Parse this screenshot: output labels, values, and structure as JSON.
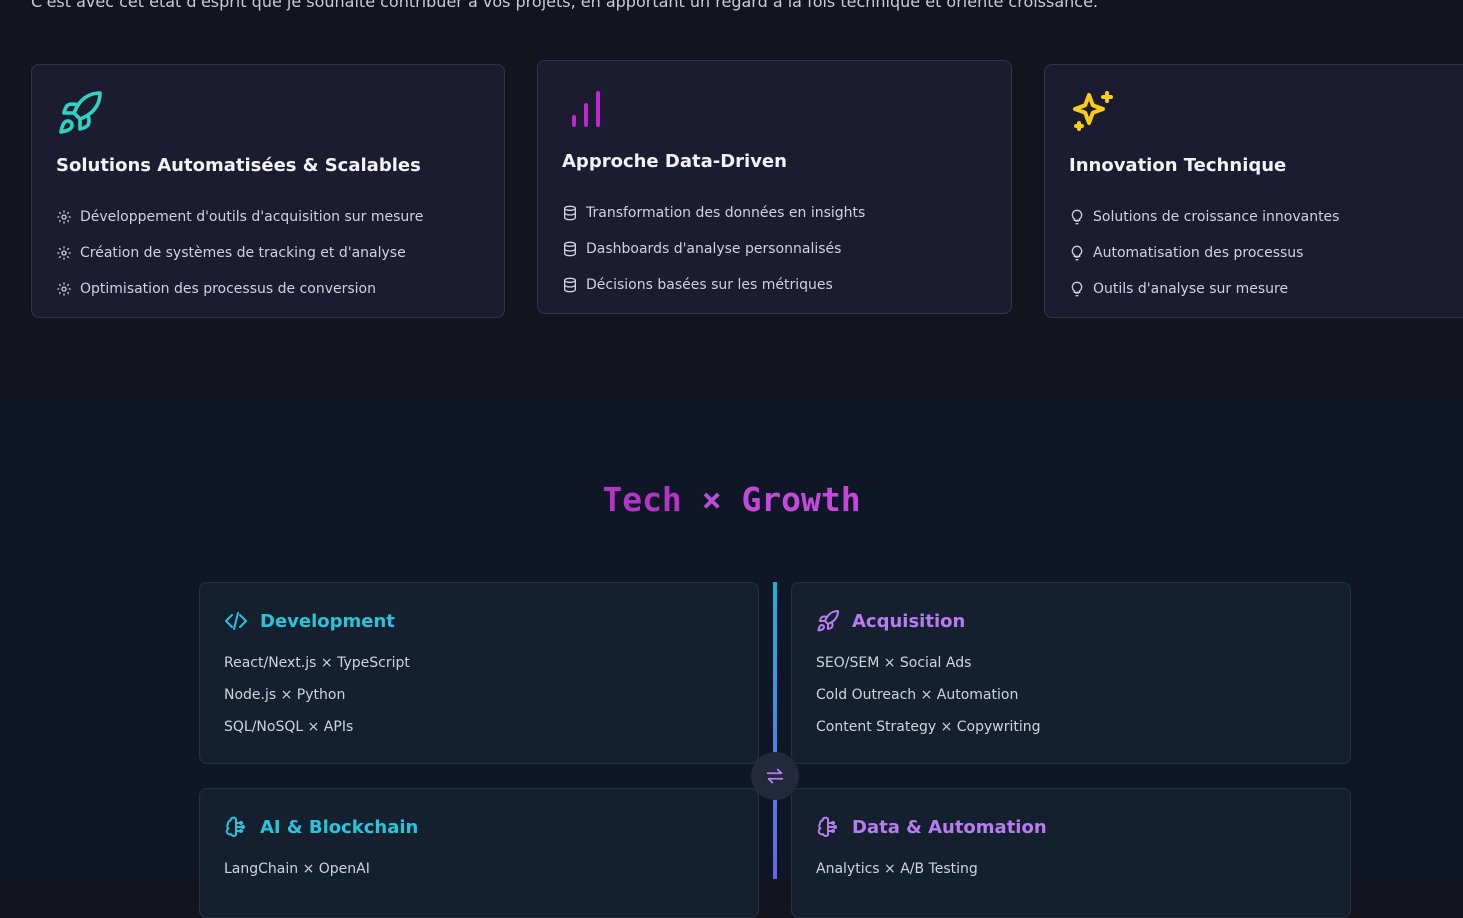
{
  "intro": {
    "text": "C'est avec cet état d'esprit que je souhaite contribuer à vos projets, en apportant un regard à la fois technique et orienté croissance."
  },
  "features": [
    {
      "icon": "rocket-icon",
      "title": "Solutions Automatisées & Scalables",
      "bullet_icon": "gear-icon",
      "items": [
        "Développement d'outils d'acquisition sur mesure",
        "Création de systèmes de tracking et d'analyse",
        "Optimisation des processus de conversion"
      ]
    },
    {
      "icon": "bar-chart-icon",
      "title": "Approche Data-Driven",
      "bullet_icon": "database-icon",
      "items": [
        "Transformation des données en insights",
        "Dashboards d'analyse personnalisés",
        "Décisions basées sur les métriques"
      ]
    },
    {
      "icon": "sparkles-icon",
      "title": "Innovation Technique",
      "bullet_icon": "lightbulb-icon",
      "items": [
        "Solutions de croissance innovantes",
        "Automatisation des processus",
        "Outils d'analyse sur mesure"
      ]
    }
  ],
  "tech_growth": {
    "title_part1": "Tech",
    "title_sep": "×",
    "title_part2": "Growth",
    "cards": [
      {
        "title": "Development",
        "icon": "code-icon",
        "items": [
          "React/Next.js × TypeScript",
          "Node.js × Python",
          "SQL/NoSQL × APIs"
        ]
      },
      {
        "title": "Acquisition",
        "icon": "rocket-icon",
        "items": [
          "SEO/SEM × Social Ads",
          "Cold Outreach × Automation",
          "Content Strategy × Copywriting"
        ]
      },
      {
        "title": "AI & Blockchain",
        "icon": "brain-icon",
        "items": [
          "LangChain × OpenAI"
        ]
      },
      {
        "title": "Data & Automation",
        "icon": "brain-icon",
        "items": [
          "Analytics × A/B Testing"
        ]
      }
    ],
    "swap_icon": "swap-arrows-icon"
  },
  "colors": {
    "teal": "#2dd4bf",
    "purple": "#c026d3",
    "yellow": "#facc15",
    "cyan": "#29c4dc",
    "violet": "#b77df0"
  }
}
